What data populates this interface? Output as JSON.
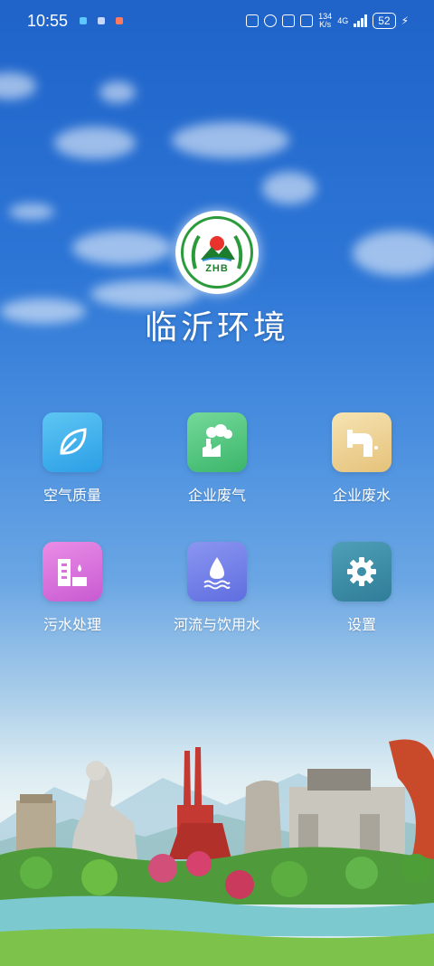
{
  "status_bar": {
    "time": "10:55",
    "net_speed_value": "134",
    "net_speed_unit": "K/s",
    "network": "4G",
    "battery": "52"
  },
  "app": {
    "logo_text": "ZHB",
    "title": "临沂环境"
  },
  "menu": [
    {
      "label": "空气质量",
      "icon": "leaf-icon",
      "color": "#3aaeea"
    },
    {
      "label": "企业废气",
      "icon": "factory-smoke-icon",
      "color": "#4cc57a"
    },
    {
      "label": "企业废水",
      "icon": "water-pipe-icon",
      "color": "#ecd095"
    },
    {
      "label": "污水处理",
      "icon": "treatment-building-icon",
      "color": "#d873dc"
    },
    {
      "label": "河流与饮用水",
      "icon": "water-drop-icon",
      "color": "#7382e8"
    },
    {
      "label": "设置",
      "icon": "gear-icon",
      "color": "#3d8ea8"
    }
  ]
}
